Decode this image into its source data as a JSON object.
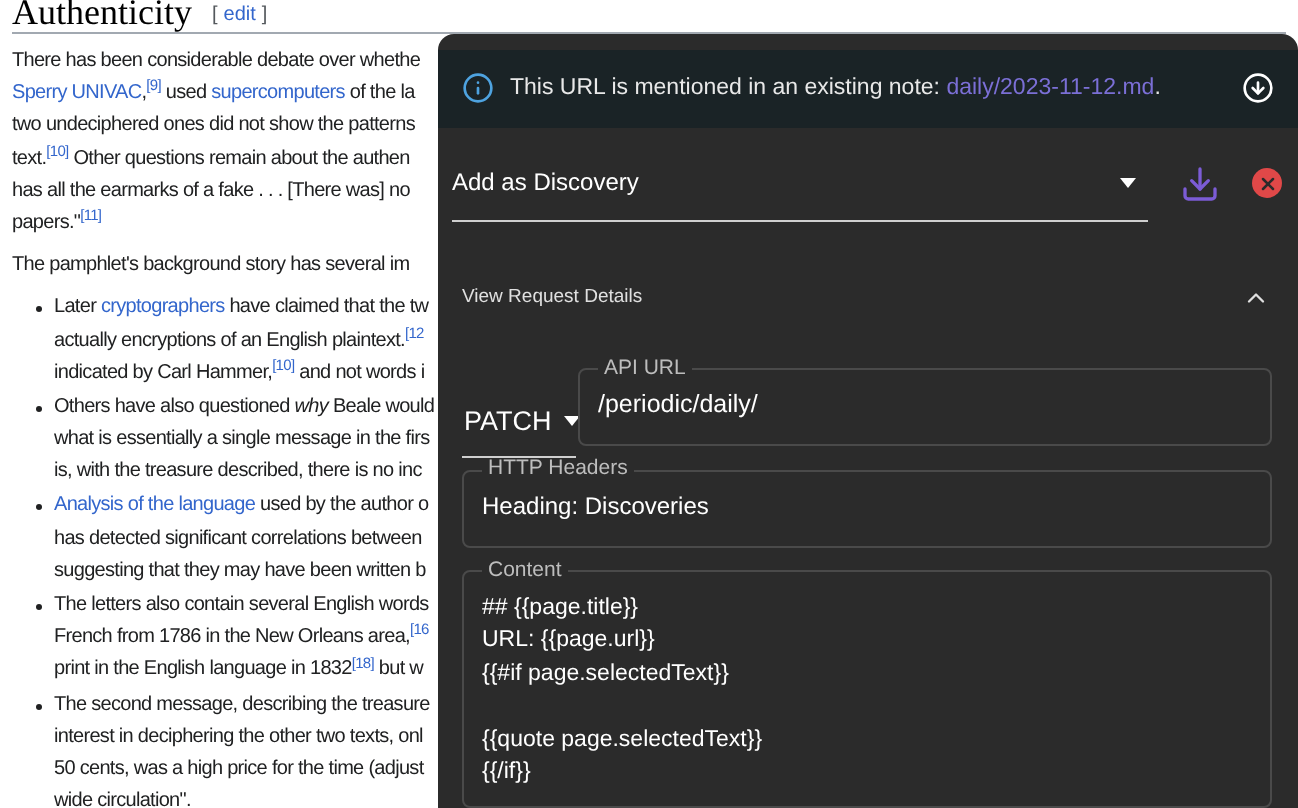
{
  "article": {
    "heading": "Authenticity",
    "edit_open": "[",
    "edit_link": "edit",
    "edit_close": "]",
    "blocks": [
      {
        "kind": "paragraph",
        "lines": [
          [
            {
              "kind": "text",
              "text": "There has been considerable debate over whethe"
            }
          ],
          [
            {
              "kind": "link",
              "text": "Sperry UNIVAC"
            },
            {
              "kind": "text",
              "text": ",$^{[9]}$ used "
            },
            {
              "kind": "link",
              "text": "supercomputers"
            },
            {
              "kind": "text",
              "text": " of the la"
            }
          ],
          [
            {
              "kind": "text",
              "text": "two undeciphered ones did not show the patterns"
            }
          ],
          [
            {
              "kind": "text",
              "text": "text.$^{[10]}$ Other questions remain about the authen"
            }
          ],
          [
            {
              "kind": "text",
              "text": "has all the earmarks of a fake . . . [There was] no"
            }
          ],
          [
            {
              "kind": "text",
              "text": "papers.\"$^{[11]}$"
            }
          ]
        ]
      },
      {
        "kind": "paragraph",
        "lines": [
          [
            {
              "kind": "text",
              "text": "The pamphlet's background story has several im"
            }
          ]
        ]
      },
      {
        "kind": "bullet",
        "lines": [
          [
            {
              "kind": "text",
              "text": "Later "
            },
            {
              "kind": "link",
              "text": "cryptographers"
            },
            {
              "kind": "text",
              "text": " have claimed that the tw"
            }
          ],
          [
            {
              "kind": "text",
              "text": "actually encryptions of an English plaintext.$^{[12}$"
            }
          ],
          [
            {
              "kind": "text",
              "text": "indicated by Carl Hammer,$^{[10]}$ and not words i"
            }
          ]
        ]
      },
      {
        "kind": "bullet",
        "lines": [
          [
            {
              "kind": "text",
              "text": "Others have also questioned *why* Beale would"
            }
          ],
          [
            {
              "kind": "text",
              "text": "what is essentially a single message in the firs"
            }
          ],
          [
            {
              "kind": "text",
              "text": "is, with the treasure described, there is no inc"
            }
          ]
        ]
      },
      {
        "kind": "bullet",
        "lines": [
          [
            {
              "kind": "link",
              "text": "Analysis of the language"
            },
            {
              "kind": "text",
              "text": " used by the author o"
            }
          ],
          [
            {
              "kind": "text",
              "text": "has detected significant correlations between"
            }
          ],
          [
            {
              "kind": "text",
              "text": "suggesting that they may have been written b"
            }
          ]
        ]
      },
      {
        "kind": "bullet",
        "lines": [
          [
            {
              "kind": "text",
              "text": "The letters also contain several English words"
            }
          ],
          [
            {
              "kind": "text",
              "text": "French from 1786 in the New Orleans area,$^{[16}$"
            }
          ],
          [
            {
              "kind": "text",
              "text": "print in the English language in 1832$^{[18]}$ but w"
            }
          ]
        ]
      },
      {
        "kind": "bullet",
        "lines": [
          [
            {
              "kind": "text",
              "text": "The second message, describing the treasure"
            }
          ],
          [
            {
              "kind": "text",
              "text": "interest in deciphering the other two texts, onl"
            }
          ],
          [
            {
              "kind": "text",
              "text": "50 cents, was a high price for the time (adjust"
            }
          ],
          [
            {
              "kind": "text",
              "text": "wide circulation\"."
            }
          ]
        ]
      }
    ]
  },
  "panel": {
    "notice": {
      "text": "This URL is mentioned in an existing note: ",
      "link": "daily/2023-11-12.md",
      "suffix": "."
    },
    "action": {
      "value": "Add as Discovery"
    },
    "details": {
      "label": "View Request Details",
      "expanded": true
    },
    "method": "PATCH",
    "api_url": {
      "label": "API URL",
      "value": "/periodic/daily/"
    },
    "headers": {
      "label": "HTTP Headers",
      "value": "Heading: Discoveries"
    },
    "content": {
      "label": "Content",
      "value": "## {{page.title}}\nURL: {{page.url}}\n{{#if page.selectedText}}\n\n{{quote page.selectedText}}\n{{/if}}"
    }
  }
}
